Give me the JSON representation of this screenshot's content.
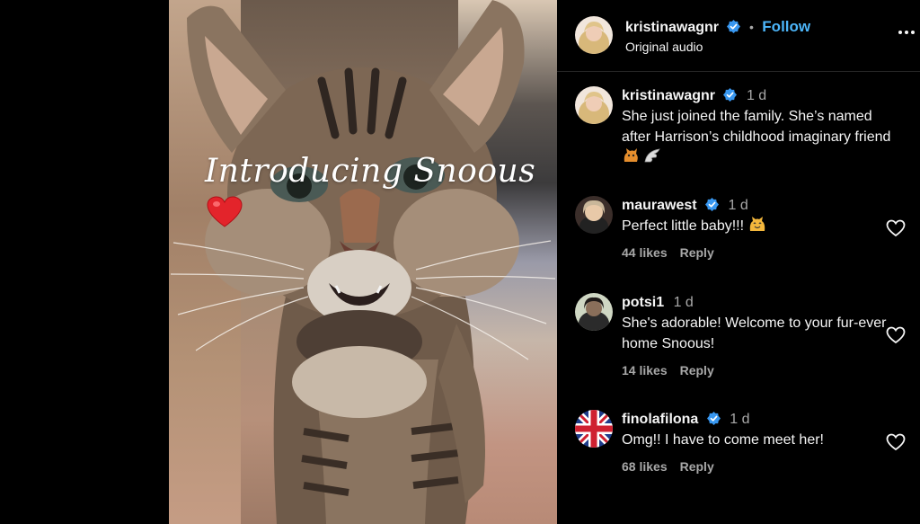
{
  "media": {
    "caption": "Introducing Snoous",
    "sticker": "red-heart"
  },
  "header": {
    "username": "kristinawagnr",
    "separator": "•",
    "follow_label": "Follow",
    "audio_label": "Original audio",
    "more_icon": "more-horizontal-icon"
  },
  "caption_comment": {
    "username": "kristinawagnr",
    "time": "1 d",
    "text": "She just joined the family. She’s named after Harrison’s childhood imaginary friend",
    "emojis": [
      "cat-emoji",
      "wing-emoji"
    ]
  },
  "comments": [
    {
      "username": "maurawest",
      "time": "1 d",
      "text": "Perfect little baby!!!",
      "emoji": "smiling-cat-emoji",
      "likes": "44 likes",
      "reply": "Reply"
    },
    {
      "username": "potsi1",
      "time": "1 d",
      "text": "She's adorable! Welcome to your fur-ever home Snoous!",
      "likes": "14 likes",
      "reply": "Reply"
    },
    {
      "username": "finolafilona",
      "time": "1 d",
      "text": "Omg!! I have to come meet her!",
      "likes": "68 likes",
      "reply": "Reply"
    }
  ],
  "colors": {
    "follow": "#4cb5f9",
    "verified": "#3897f0",
    "muted": "#a8a8a8",
    "background": "#000000"
  }
}
